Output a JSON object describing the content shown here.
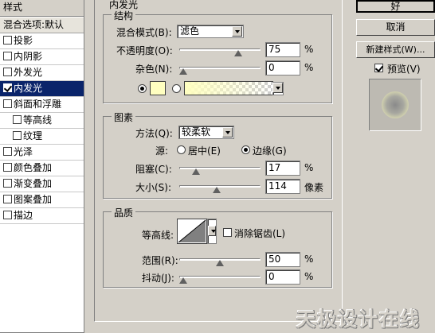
{
  "sidebar": {
    "header": "样式",
    "blending": "混合选项:默认",
    "items": [
      {
        "label": "投影",
        "checked": false,
        "indent": false
      },
      {
        "label": "内阴影",
        "checked": false,
        "indent": false
      },
      {
        "label": "外发光",
        "checked": false,
        "indent": false
      },
      {
        "label": "内发光",
        "checked": true,
        "indent": false,
        "selected": true
      },
      {
        "label": "斜面和浮雕",
        "checked": false,
        "indent": false
      },
      {
        "label": "等高线",
        "checked": false,
        "indent": true
      },
      {
        "label": "纹理",
        "checked": false,
        "indent": true
      },
      {
        "label": "光泽",
        "checked": false,
        "indent": false
      },
      {
        "label": "颜色叠加",
        "checked": false,
        "indent": false
      },
      {
        "label": "渐变叠加",
        "checked": false,
        "indent": false
      },
      {
        "label": "图案叠加",
        "checked": false,
        "indent": false
      },
      {
        "label": "描边",
        "checked": false,
        "indent": false
      }
    ]
  },
  "main": {
    "title": "内发光",
    "structure": {
      "title": "结构",
      "blend_mode_label": "混合模式(B):",
      "blend_mode_value": "滤色",
      "opacity_label": "不透明度(O):",
      "opacity_value": "75",
      "opacity_unit": "%",
      "opacity_level": 0.75,
      "noise_label": "杂色(N):",
      "noise_value": "0",
      "noise_unit": "%",
      "noise_level": 0,
      "solid_color": "#ffffc0",
      "gradient_from": "#ffffc0"
    },
    "elements": {
      "title": "图素",
      "technique_label": "方法(Q):",
      "technique_value": "较柔软",
      "source_label": "源:",
      "source_center": "居中(E)",
      "source_edge": "边缘(G)",
      "choke_label": "阻塞(C):",
      "choke_value": "17",
      "choke_unit": "%",
      "choke_level": 0.17,
      "size_label": "大小(S):",
      "size_value": "114",
      "size_unit": "像素",
      "size_level": 0.46
    },
    "quality": {
      "title": "品质",
      "contour_label": "等高线:",
      "antialias_label": "消除锯齿(L)",
      "range_label": "范围(R):",
      "range_value": "50",
      "range_unit": "%",
      "range_level": 0.5,
      "jitter_label": "抖动(J):",
      "jitter_value": "0",
      "jitter_unit": "%",
      "jitter_level": 0
    }
  },
  "buttons": {
    "ok": "好",
    "cancel": "取消",
    "new_style": "新建样式(W)...",
    "preview_label": "预览(V)",
    "preview_checked": true
  },
  "watermark": "天极设计在线"
}
